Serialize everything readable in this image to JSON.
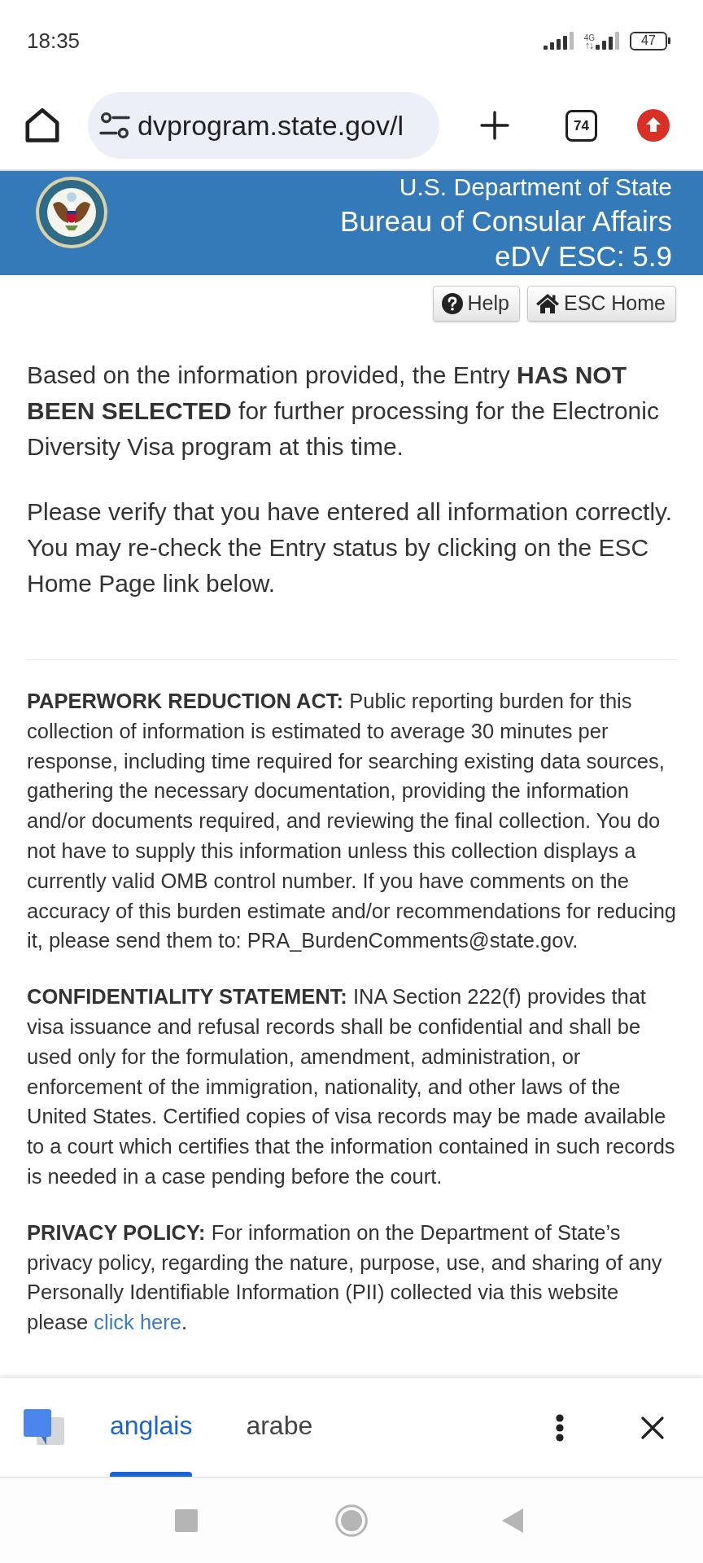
{
  "status_bar": {
    "time": "18:35",
    "network": "4G",
    "battery": "47"
  },
  "browser": {
    "url": "dvprogram.state.gov/l",
    "tab_count": "74"
  },
  "banner": {
    "department": "U.S. Department of State",
    "bureau": "Bureau of Consular Affairs",
    "version": "eDV ESC: 5.9"
  },
  "toolbar": {
    "help_button": "Help",
    "home_button": "ESC Home"
  },
  "result": [
    "Based on the information provided, the Entry **HAS NOT BEEN SELECTED** for further processing for the Electronic Diversity Visa program at this time.",
    "Please verify that you have entered all information correctly. You may re-check the Entry status by clicking on the ESC Home Page link below."
  ],
  "notices": [
    {
      "text": "**PAPERWORK REDUCTION ACT:** Public reporting burden for this collection of information is estimated to average 30 minutes per response, including time required for searching existing data sources, gathering the necessary documentation, providing the information and/or documents required, and reviewing the final collection. You do not have to supply this information unless this collection displays a currently valid OMB control number. If you have comments on the accuracy of this burden estimate and/or recommendations for reducing it, please send them to: PRA_BurdenComments@state.gov."
    },
    {
      "text": "**CONFIDENTIALITY STATEMENT:** INA Section 222(f) provides that visa issuance and refusal records shall be confidential and shall be used only for the formulation, amendment, administration, or enforcement of the immigration, nationality, and other laws of the United States. Certified copies of visa records may be made available to a court which certifies that the information contained in such records is needed in a case pending before the court."
    },
    {
      "text": "**PRIVACY POLICY:** For information on the Department of State’s privacy policy, regarding the nature, purpose, use, and sharing of any Personally Identifiable Information (PII) collected via this website please",
      "link": "click here",
      "after_link": "."
    }
  ],
  "translate_bar": {
    "languages": [
      {
        "label": "anglais",
        "selected": true
      },
      {
        "label": "arabe",
        "selected": false
      }
    ]
  }
}
